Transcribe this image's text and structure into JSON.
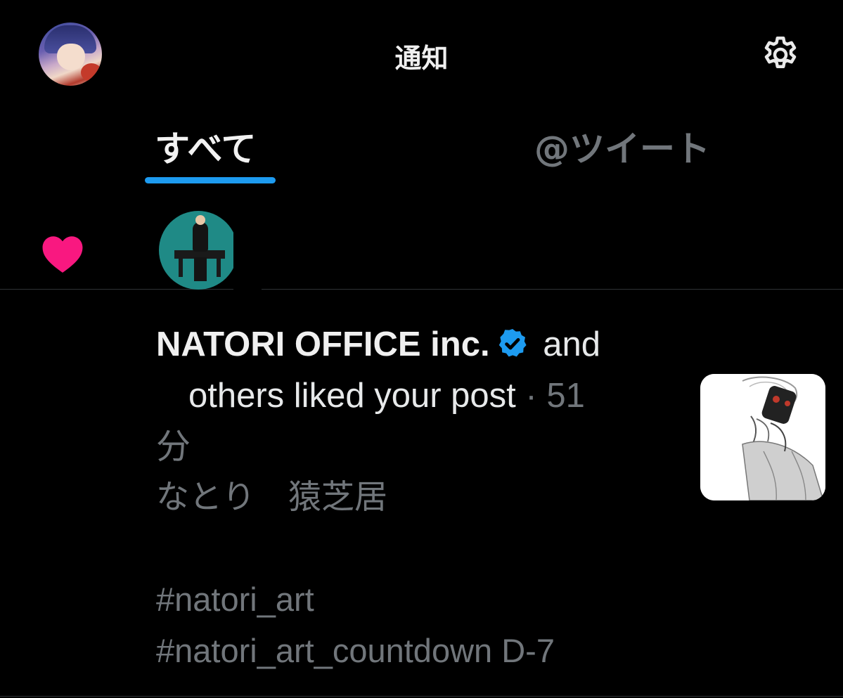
{
  "header": {
    "title": "通知"
  },
  "tabs": [
    {
      "label": "すべて",
      "active": true
    },
    {
      "label": "@ツイート",
      "active": false
    }
  ],
  "notification": {
    "account_name": "NATORI OFFICE inc.",
    "verified": true,
    "conjunction": "and",
    "action_text": "others liked your post",
    "separator": "·",
    "time": "51",
    "time_unit": "分",
    "post_lines": [
      "なとり　猿芝居",
      "",
      "#natori_art",
      "#natori_art_countdown D-7"
    ]
  },
  "colors": {
    "background": "#000000",
    "accent": "#1d9bf0",
    "like": "#f91880",
    "secondary_text": "#71767b"
  },
  "icons": {
    "settings": "gear-icon",
    "like": "heart-icon",
    "verified": "verified-badge-icon"
  }
}
